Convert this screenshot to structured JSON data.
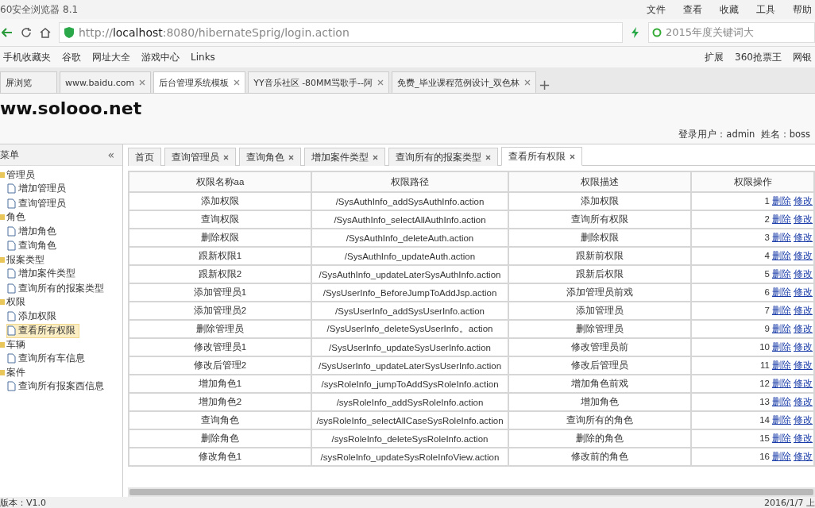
{
  "browser": {
    "title": "60安全浏览器 8.1",
    "menu": [
      "文件",
      "查看",
      "收藏",
      "工具",
      "帮助"
    ],
    "url_host": "localhost",
    "url_prefix": "http://",
    "url_rest": ":8080/hibernateSprig/login.action",
    "search": "2015年度关键词大",
    "bookmarks": [
      "手机收藏夹",
      "谷歌",
      "网址大全",
      "游戏中心",
      "Links"
    ],
    "extras": [
      "扩展",
      "360抢票王",
      "网银"
    ],
    "tabs": [
      {
        "label": "屏浏览",
        "selected": false,
        "closable": false
      },
      {
        "label": "www.baidu.com",
        "selected": false,
        "closable": true
      },
      {
        "label": "后台管理系统模板",
        "selected": true,
        "closable": true
      },
      {
        "label": "YY音乐社区 -80MM骂歌手--阿",
        "selected": false,
        "closable": true
      },
      {
        "label": "免费_毕业课程范例设计_双色林",
        "selected": false,
        "closable": true
      }
    ],
    "new_tab": "+"
  },
  "header": {
    "logo": "ww.solooo.net",
    "user_info": "登录用户：admin  姓名：boss"
  },
  "sidebar": {
    "title": "菜单",
    "collapse": "«",
    "items": [
      {
        "label": "管理员",
        "children": [
          {
            "label": "增加管理员",
            "selected": false
          },
          {
            "label": "查询管理员",
            "selected": false
          }
        ]
      },
      {
        "label": "角色",
        "children": [
          {
            "label": "增加角色",
            "selected": false
          },
          {
            "label": "查询角色",
            "selected": false
          }
        ]
      },
      {
        "label": "报案类型",
        "children": [
          {
            "label": "增加案件类型",
            "selected": false
          },
          {
            "label": "查询所有的报案类型",
            "selected": false
          }
        ]
      },
      {
        "label": "权限",
        "children": [
          {
            "label": "添加权限",
            "selected": false
          },
          {
            "label": "查看所有权限",
            "selected": true
          }
        ]
      },
      {
        "label": "车辆",
        "children": [
          {
            "label": "查询所有车信息",
            "selected": false
          }
        ]
      },
      {
        "label": "案件",
        "children": [
          {
            "label": "查询所有报案西信息",
            "selected": false
          }
        ]
      }
    ]
  },
  "page_tabs": [
    {
      "label": "首页",
      "selected": false,
      "closable": false
    },
    {
      "label": "查询管理员",
      "selected": false,
      "closable": true
    },
    {
      "label": "查询角色",
      "selected": false,
      "closable": true
    },
    {
      "label": "增加案件类型",
      "selected": false,
      "closable": true
    },
    {
      "label": "查询所有的报案类型",
      "selected": false,
      "closable": true
    },
    {
      "label": "查看所有权限",
      "selected": true,
      "closable": true
    }
  ],
  "table": {
    "columns": [
      "权限名称aa",
      "权限路径",
      "权限描述",
      "权限操作"
    ],
    "rows": [
      {
        "name": "添加权限",
        "path": "/SysAuthInfo_addSysAuthInfo.action",
        "desc": "添加权限",
        "id": "1",
        "actions": [
          "删除",
          "修改"
        ]
      },
      {
        "name": "查询权限",
        "path": "/SysAuthInfo_selectAllAuthInfo.action",
        "desc": "查询所有权限",
        "id": "2",
        "actions": [
          "删除",
          "修改"
        ]
      },
      {
        "name": "删除权限",
        "path": "/SysAuthInfo_deleteAuth.action",
        "desc": "删除权限",
        "id": "3",
        "actions": [
          "删除",
          "修改"
        ]
      },
      {
        "name": "跟新权限1",
        "path": "/SysAuthInfo_updateAuth.action",
        "desc": "跟新前权限",
        "id": "4",
        "actions": [
          "删除",
          "修改"
        ]
      },
      {
        "name": "跟新权限2",
        "path": "/SysAuthInfo_updateLaterSysAuthInfo.action",
        "desc": "跟新后权限",
        "id": "5",
        "actions": [
          "删除",
          "修改"
        ]
      },
      {
        "name": "添加管理员1",
        "path": "/SysUserInfo_BeforeJumpToAddJsp.action",
        "desc": "添加管理员前戏",
        "id": "6",
        "actions": [
          "删除",
          "修改"
        ]
      },
      {
        "name": "添加管理员2",
        "path": "/SysUserInfo_addSysUserInfo.action",
        "desc": "添加管理员",
        "id": "7",
        "actions": [
          "删除",
          "修改"
        ]
      },
      {
        "name": "删除管理员",
        "path": "/SysUserInfo_deleteSysUserInfo。action",
        "desc": "删除管理员",
        "id": "9",
        "actions": [
          "删除",
          "修改"
        ]
      },
      {
        "name": "修改管理员1",
        "path": "/SysUserInfo_updateSysUserInfo.action",
        "desc": "修改管理员前",
        "id": "10",
        "actions": [
          "删除",
          "修改"
        ]
      },
      {
        "name": "修改后管理2",
        "path": "/SysUserInfo_updateLaterSysUserInfo.action",
        "desc": "修改后管理员",
        "id": "11",
        "actions": [
          "删除",
          "修改"
        ]
      },
      {
        "name": "增加角色1",
        "path": "/sysRoleInfo_jumpToAddSysRoleInfo.action",
        "desc": "增加角色前戏",
        "id": "12",
        "actions": [
          "删除",
          "修改"
        ]
      },
      {
        "name": "增加角色2",
        "path": "/sysRoleInfo_addSysRoleInfo.action",
        "desc": "增加角色",
        "id": "13",
        "actions": [
          "删除",
          "修改"
        ]
      },
      {
        "name": "查询角色",
        "path": "/sysRoleInfo_selectAllCaseSysRoleInfo.action",
        "desc": "查询所有的角色",
        "id": "14",
        "actions": [
          "删除",
          "修改"
        ]
      },
      {
        "name": "删除角色",
        "path": "/sysRoleInfo_deleteSysRoleInfo.action",
        "desc": "删除的角色",
        "id": "15",
        "actions": [
          "删除",
          "修改"
        ]
      },
      {
        "name": "修改角色1",
        "path": "/sysRoleInfo_updateSysRoleInfoView.action",
        "desc": "修改前的角色",
        "id": "16",
        "actions": [
          "删除",
          "修改"
        ]
      }
    ]
  },
  "footer": {
    "version": "版本：V1.0",
    "date": "2016/1/7 上"
  }
}
